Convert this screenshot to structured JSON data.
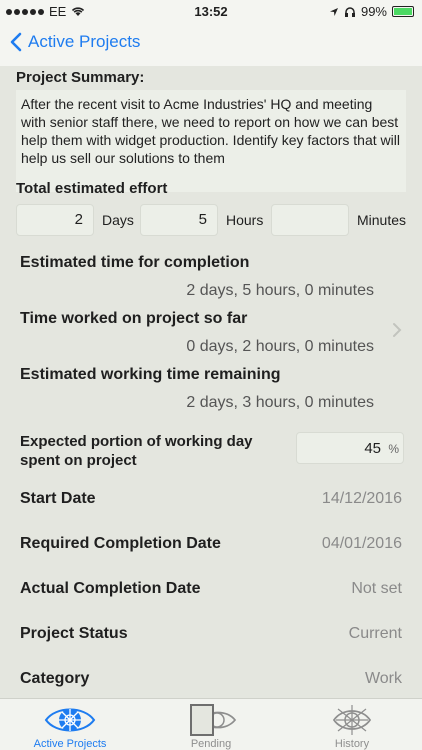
{
  "status_bar": {
    "carrier": "EE",
    "time": "13:52",
    "battery": "99%"
  },
  "nav": {
    "back_label": "Active Projects"
  },
  "summary": {
    "title": "Project Summary:",
    "text": "After the recent visit to Acme Industries' HQ and meeting with senior staff there, we need to report on how we can best help them with widget production.  Identify key factors that will help us sell our solutions to them"
  },
  "effort": {
    "title": "Total estimated effort",
    "days_value": "2",
    "days_label": "Days",
    "hours_value": "5",
    "hours_label": "Hours",
    "minutes_value": "",
    "minutes_label": "Minutes"
  },
  "completion": {
    "label": "Estimated time for completion",
    "value": "2 days, 5 hours, 0 minutes"
  },
  "worked": {
    "label": "Time worked on project so far",
    "value": "0 days, 2 hours, 0 minutes"
  },
  "remaining": {
    "label": "Estimated working time remaining",
    "value": "2 days, 3 hours, 0 minutes"
  },
  "portion": {
    "label": "Expected portion of working day spent on project",
    "value": "45",
    "unit": "%"
  },
  "details": [
    {
      "label": "Start Date",
      "value": "14/12/2016"
    },
    {
      "label": "Required Completion Date",
      "value": "04/01/2016"
    },
    {
      "label": "Actual Completion Date",
      "value": "Not set"
    },
    {
      "label": "Project Status",
      "value": "Current"
    },
    {
      "label": "Category",
      "value": "Work"
    }
  ],
  "tabs": [
    {
      "label": "Active Projects",
      "icon": "eye-icon",
      "active": true
    },
    {
      "label": "Pending",
      "icon": "door-eye-icon",
      "active": false
    },
    {
      "label": "History",
      "icon": "web-eye-icon",
      "active": false
    }
  ],
  "colors": {
    "accent": "#1e7cf0",
    "background": "#e4e6df",
    "battery": "#4cd964"
  }
}
